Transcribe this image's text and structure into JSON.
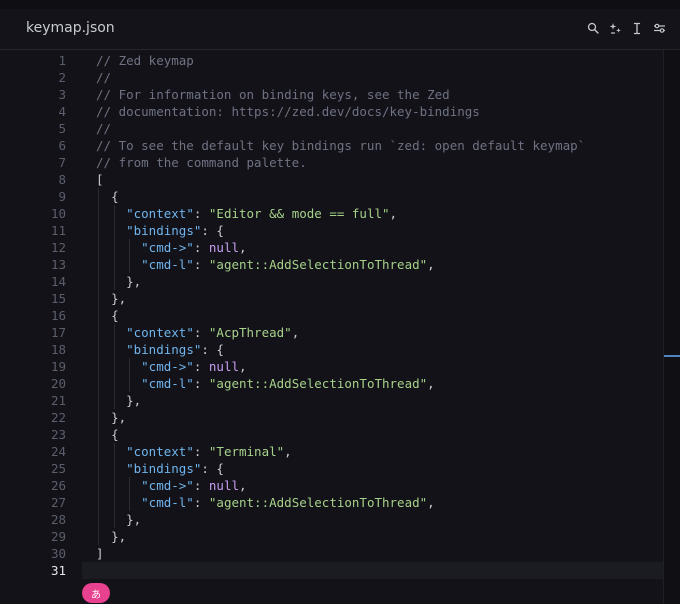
{
  "tab": {
    "title": "keymap.json"
  },
  "toolbar": {
    "icons": [
      "search-icon",
      "sparkle-icon",
      "text-cursor-icon",
      "settings-sliders-icon"
    ]
  },
  "editor": {
    "active_line": 31,
    "lines": [
      {
        "n": "1",
        "indent": 0,
        "tokens": [
          {
            "t": "// Zed keymap",
            "c": "comment"
          }
        ]
      },
      {
        "n": "2",
        "indent": 0,
        "tokens": [
          {
            "t": "//",
            "c": "comment"
          }
        ]
      },
      {
        "n": "3",
        "indent": 0,
        "tokens": [
          {
            "t": "// For information on binding keys, see the Zed",
            "c": "comment"
          }
        ]
      },
      {
        "n": "4",
        "indent": 0,
        "tokens": [
          {
            "t": "// documentation: https://zed.dev/docs/key-bindings",
            "c": "comment"
          }
        ]
      },
      {
        "n": "5",
        "indent": 0,
        "tokens": [
          {
            "t": "//",
            "c": "comment"
          }
        ]
      },
      {
        "n": "6",
        "indent": 0,
        "tokens": [
          {
            "t": "// To see the default key bindings run `zed: open default keymap`",
            "c": "comment"
          }
        ]
      },
      {
        "n": "7",
        "indent": 0,
        "tokens": [
          {
            "t": "// from the command palette.",
            "c": "comment"
          }
        ]
      },
      {
        "n": "8",
        "indent": 0,
        "tokens": [
          {
            "t": "[",
            "c": "punct"
          }
        ]
      },
      {
        "n": "9",
        "indent": 1,
        "tokens": [
          {
            "t": "{",
            "c": "punct"
          }
        ]
      },
      {
        "n": "10",
        "indent": 2,
        "tokens": [
          {
            "t": "\"context\"",
            "c": "key"
          },
          {
            "t": ": ",
            "c": "punct"
          },
          {
            "t": "\"Editor && mode == full\"",
            "c": "string"
          },
          {
            "t": ",",
            "c": "punct"
          }
        ]
      },
      {
        "n": "11",
        "indent": 2,
        "tokens": [
          {
            "t": "\"bindings\"",
            "c": "key"
          },
          {
            "t": ": {",
            "c": "punct"
          }
        ]
      },
      {
        "n": "12",
        "indent": 3,
        "tokens": [
          {
            "t": "\"cmd->\"",
            "c": "key"
          },
          {
            "t": ": ",
            "c": "punct"
          },
          {
            "t": "null",
            "c": "null"
          },
          {
            "t": ",",
            "c": "punct"
          }
        ]
      },
      {
        "n": "13",
        "indent": 3,
        "tokens": [
          {
            "t": "\"cmd-l\"",
            "c": "key"
          },
          {
            "t": ": ",
            "c": "punct"
          },
          {
            "t": "\"agent::AddSelectionToThread\"",
            "c": "string"
          },
          {
            "t": ",",
            "c": "punct"
          }
        ]
      },
      {
        "n": "14",
        "indent": 2,
        "tokens": [
          {
            "t": "},",
            "c": "punct"
          }
        ]
      },
      {
        "n": "15",
        "indent": 1,
        "tokens": [
          {
            "t": "},",
            "c": "punct"
          }
        ]
      },
      {
        "n": "16",
        "indent": 1,
        "tokens": [
          {
            "t": "{",
            "c": "punct"
          }
        ]
      },
      {
        "n": "17",
        "indent": 2,
        "tokens": [
          {
            "t": "\"context\"",
            "c": "key"
          },
          {
            "t": ": ",
            "c": "punct"
          },
          {
            "t": "\"AcpThread\"",
            "c": "string"
          },
          {
            "t": ",",
            "c": "punct"
          }
        ]
      },
      {
        "n": "18",
        "indent": 2,
        "tokens": [
          {
            "t": "\"bindings\"",
            "c": "key"
          },
          {
            "t": ": {",
            "c": "punct"
          }
        ]
      },
      {
        "n": "19",
        "indent": 3,
        "tokens": [
          {
            "t": "\"cmd->\"",
            "c": "key"
          },
          {
            "t": ": ",
            "c": "punct"
          },
          {
            "t": "null",
            "c": "null"
          },
          {
            "t": ",",
            "c": "punct"
          }
        ]
      },
      {
        "n": "20",
        "indent": 3,
        "tokens": [
          {
            "t": "\"cmd-l\"",
            "c": "key"
          },
          {
            "t": ": ",
            "c": "punct"
          },
          {
            "t": "\"agent::AddSelectionToThread\"",
            "c": "string"
          },
          {
            "t": ",",
            "c": "punct"
          }
        ]
      },
      {
        "n": "21",
        "indent": 2,
        "tokens": [
          {
            "t": "},",
            "c": "punct"
          }
        ]
      },
      {
        "n": "22",
        "indent": 1,
        "tokens": [
          {
            "t": "},",
            "c": "punct"
          }
        ]
      },
      {
        "n": "23",
        "indent": 1,
        "tokens": [
          {
            "t": "{",
            "c": "punct"
          }
        ]
      },
      {
        "n": "24",
        "indent": 2,
        "tokens": [
          {
            "t": "\"context\"",
            "c": "key"
          },
          {
            "t": ": ",
            "c": "punct"
          },
          {
            "t": "\"Terminal\"",
            "c": "string"
          },
          {
            "t": ",",
            "c": "punct"
          }
        ]
      },
      {
        "n": "25",
        "indent": 2,
        "tokens": [
          {
            "t": "\"bindings\"",
            "c": "key"
          },
          {
            "t": ": {",
            "c": "punct"
          }
        ]
      },
      {
        "n": "26",
        "indent": 3,
        "tokens": [
          {
            "t": "\"cmd->\"",
            "c": "key"
          },
          {
            "t": ": ",
            "c": "punct"
          },
          {
            "t": "null",
            "c": "null"
          },
          {
            "t": ",",
            "c": "punct"
          }
        ]
      },
      {
        "n": "27",
        "indent": 3,
        "tokens": [
          {
            "t": "\"cmd-l\"",
            "c": "key"
          },
          {
            "t": ": ",
            "c": "punct"
          },
          {
            "t": "\"agent::AddSelectionToThread\"",
            "c": "string"
          },
          {
            "t": ",",
            "c": "punct"
          }
        ]
      },
      {
        "n": "28",
        "indent": 2,
        "tokens": [
          {
            "t": "},",
            "c": "punct"
          }
        ]
      },
      {
        "n": "29",
        "indent": 1,
        "tokens": [
          {
            "t": "},",
            "c": "punct"
          }
        ]
      },
      {
        "n": "30",
        "indent": 0,
        "tokens": [
          {
            "t": "]",
            "c": "punct"
          }
        ]
      },
      {
        "n": "31",
        "indent": 0,
        "tokens": []
      }
    ]
  },
  "ime": {
    "label": "あ"
  },
  "colors": {
    "comment": "#6f7283",
    "key": "#6fb5ee",
    "string": "#a6d189",
    "null": "#c79ef2",
    "ime_badge": "#e8418f"
  }
}
